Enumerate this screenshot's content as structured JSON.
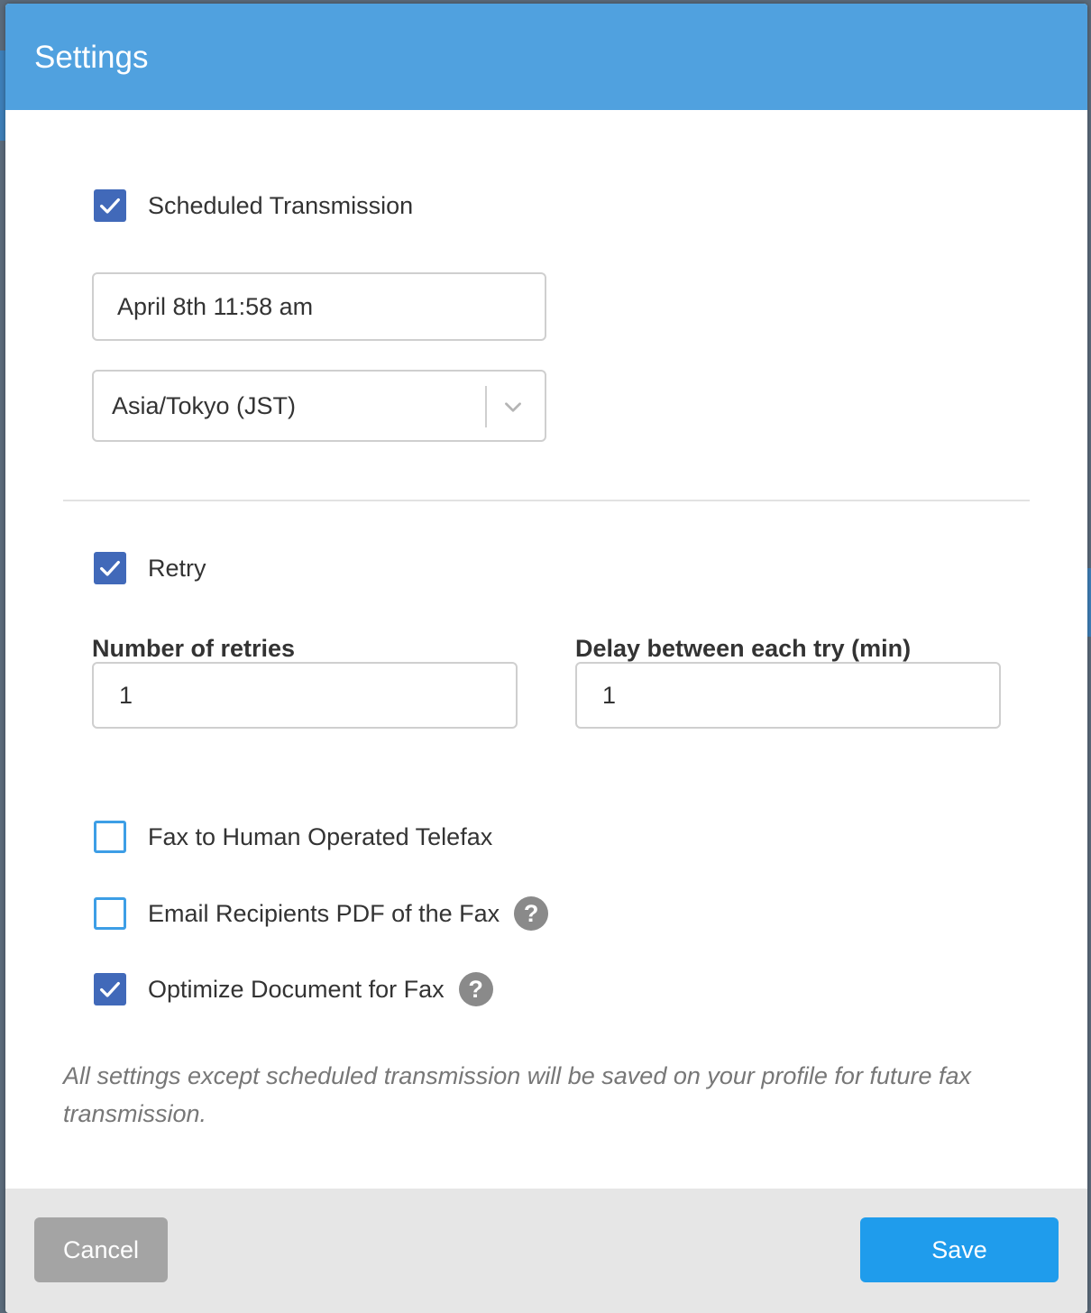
{
  "dialog": {
    "title": "Settings"
  },
  "scheduled": {
    "label": "Scheduled Transmission",
    "checked": true,
    "datetime_value": "April 8th 11:58 am",
    "timezone_value": "Asia/Tokyo (JST)"
  },
  "retry": {
    "label": "Retry",
    "checked": true,
    "number_label": "Number of retries",
    "number_value": "1",
    "delay_label": "Delay between each try (min)",
    "delay_value": "1"
  },
  "options": [
    {
      "label": "Fax to Human Operated Telefax",
      "checked": false,
      "has_help": false
    },
    {
      "label": "Email Recipients PDF of the Fax",
      "checked": false,
      "has_help": true
    },
    {
      "label": "Optimize Document for Fax",
      "checked": true,
      "has_help": true
    }
  ],
  "help_icon_glyph": "?",
  "note": "All settings except scheduled transmission will be saved on your profile for future fax transmission.",
  "footer": {
    "cancel_label": "Cancel",
    "save_label": "Save"
  },
  "colors": {
    "header": "#50a1df",
    "checkbox_checked": "#4169b9",
    "checkbox_unchecked_border": "#3d9ee6",
    "save_button": "#1f9cec",
    "cancel_button": "#a4a4a4"
  }
}
